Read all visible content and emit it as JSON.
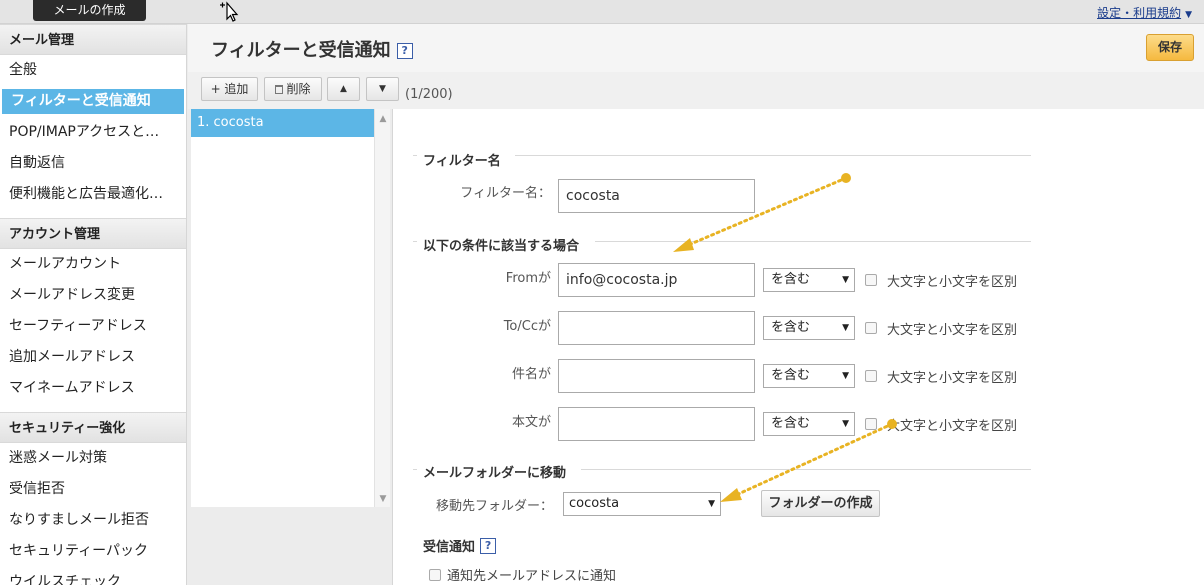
{
  "topbar": {
    "compose_label": "メールの作成",
    "settings_label": "設定・利用規約",
    "settings_caret": "▼"
  },
  "sidebar": {
    "sections": [
      {
        "title": "メール管理",
        "items": [
          "全般",
          "フィルターと受信通知",
          "POP/IMAPアクセスと…",
          "自動返信",
          "便利機能と広告最適化…"
        ]
      },
      {
        "title": "アカウント管理",
        "items": [
          "メールアカウント",
          "メールアドレス変更",
          "セーフティーアドレス",
          "追加メールアドレス",
          "マイネームアドレス"
        ]
      },
      {
        "title": "セキュリティー強化",
        "items": [
          "迷惑メール対策",
          "受信拒否",
          "なりすましメール拒否",
          "セキュリティーパック",
          "ウイルスチェック"
        ]
      }
    ],
    "active_item": "フィルターと受信通知"
  },
  "header": {
    "title": "フィルターと受信通知",
    "help": "?",
    "save_label": "保存"
  },
  "toolbar": {
    "add_label": "+ 追加",
    "delete_label": "削除",
    "up_label": "▲",
    "down_label": "▼",
    "count": "(1/200)"
  },
  "filter_list": {
    "items": [
      "1. cocosta"
    ]
  },
  "form": {
    "filter_name_section": "フィルター名",
    "filter_name_label": "フィルター名：",
    "filter_name_value": "cocosta",
    "conditions_section": "以下の条件に該当する場合",
    "conditions": [
      {
        "label": "Fromが",
        "value": "info@cocosta.jp",
        "operator": "を含む",
        "case_label": "大文字と小文字を区別"
      },
      {
        "label": "To/Ccが",
        "value": "",
        "operator": "を含む",
        "case_label": "大文字と小文字を区別"
      },
      {
        "label": "件名が",
        "value": "",
        "operator": "を含む",
        "case_label": "大文字と小文字を区別"
      },
      {
        "label": "本文が",
        "value": "",
        "operator": "を含む",
        "case_label": "大文字と小文字を区別"
      }
    ],
    "move_section": "メールフォルダーに移動",
    "move_label": "移動先フォルダー：",
    "move_value": "cocosta",
    "create_folder_label": "フォルダーの作成",
    "notify_section": "受信通知",
    "notify_help": "?",
    "notify_checkbox_label": "通知先メールアドレスに通知"
  },
  "colors": {
    "active_blue": "#5cb6e6",
    "save_orange": "#f5b93f",
    "annotation_arrow": "#e8b323"
  }
}
